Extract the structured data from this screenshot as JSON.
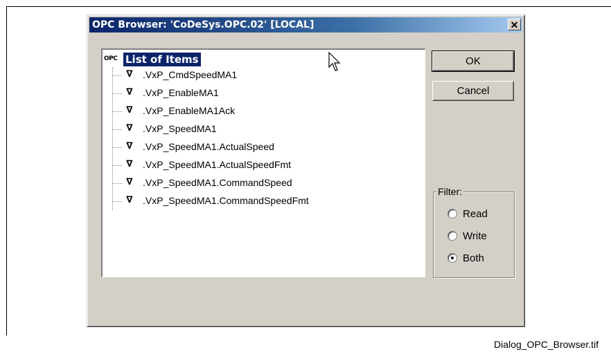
{
  "dialog": {
    "title": "OPC Browser: 'CoDeSys.OPC.02' [LOCAL]",
    "close_label": "✕"
  },
  "tree": {
    "root_icon_text": "OPC",
    "root_label": "List of Items",
    "items": [
      {
        "label": ".VxP_CmdSpeedMA1"
      },
      {
        "label": ".VxP_EnableMA1"
      },
      {
        "label": ".VxP_EnableMA1Ack"
      },
      {
        "label": ".VxP_SpeedMA1"
      },
      {
        "label": ".VxP_SpeedMA1.ActualSpeed"
      },
      {
        "label": ".VxP_SpeedMA1.ActualSpeedFmt"
      },
      {
        "label": ".VxP_SpeedMA1.CommandSpeed"
      },
      {
        "label": ".VxP_SpeedMA1.CommandSpeedFmt"
      }
    ],
    "item_icon": "variable-icon"
  },
  "buttons": {
    "ok_label": "OK",
    "cancel_label": "Cancel"
  },
  "filter": {
    "legend": "Filter:",
    "options": [
      {
        "label": "Read",
        "checked": false
      },
      {
        "label": "Write",
        "checked": false
      },
      {
        "label": "Both",
        "checked": true
      }
    ]
  },
  "caption": "Dialog_OPC_Browser.tif",
  "colors": {
    "titlebar_start": "#0a246a",
    "titlebar_end": "#a6caf0",
    "dialog_face": "#d4d0c8",
    "selection": "#0a246a"
  }
}
